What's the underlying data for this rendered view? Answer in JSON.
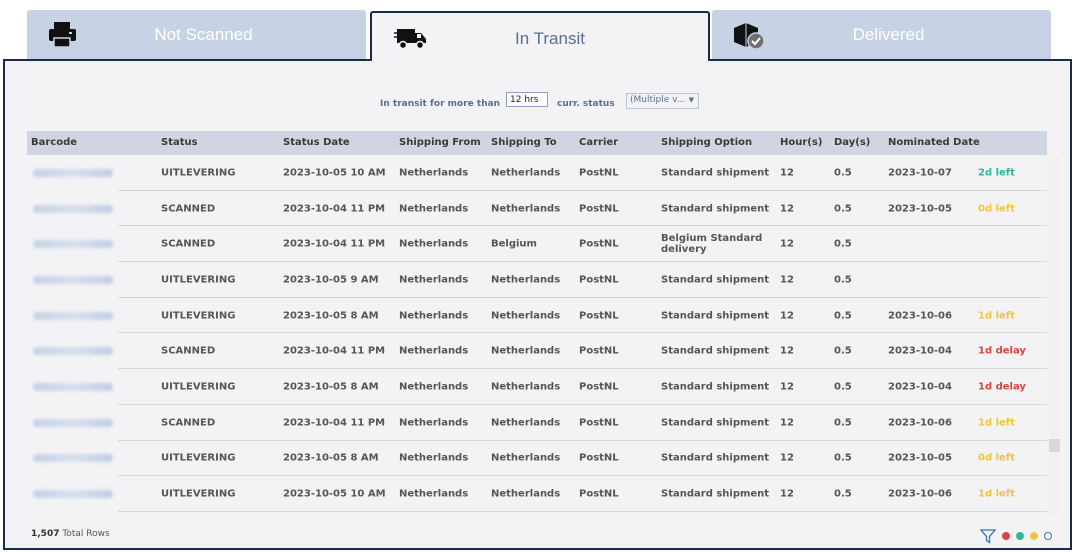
{
  "tabs": [
    {
      "label": "Not Scanned",
      "icon": "printer-icon",
      "active": false
    },
    {
      "label": "In Transit",
      "icon": "truck-icon",
      "active": true
    },
    {
      "label": "Delivered",
      "icon": "package-check-icon",
      "active": false
    }
  ],
  "filters": {
    "in_transit_label": "In transit for more than",
    "hours_value": "12 hrs",
    "status_label": "curr. status",
    "status_value": "(Multiple v...",
    "caret": "▼"
  },
  "table": {
    "columns": [
      "Barcode",
      "Status",
      "Status Date",
      "Shipping From",
      "Shipping To",
      "Carrier",
      "Shipping Option",
      "Hour(s)",
      "Day(s)",
      "Nominated Date"
    ],
    "rows": [
      {
        "status": "UITLEVERING",
        "date": "2023-10-05 10 AM",
        "from": "Netherlands",
        "to": "Netherlands",
        "carrier": "PostNL",
        "option": "Standard shipment",
        "hours": "12",
        "days": "0.5",
        "nominated": "2023-10-07",
        "left": "2d left",
        "left_color": "green"
      },
      {
        "status": "SCANNED",
        "date": "2023-10-04 11 PM",
        "from": "Netherlands",
        "to": "Netherlands",
        "carrier": "PostNL",
        "option": "Standard shipment",
        "hours": "12",
        "days": "0.5",
        "nominated": "2023-10-05",
        "left": "0d left",
        "left_color": "yellow"
      },
      {
        "status": "SCANNED",
        "date": "2023-10-04 11 PM",
        "from": "Netherlands",
        "to": "Belgium",
        "carrier": "PostNL",
        "option": "Belgium Standard\ndelivery",
        "hours": "12",
        "days": "0.5",
        "nominated": "",
        "left": "",
        "left_color": ""
      },
      {
        "status": "UITLEVERING",
        "date": "2023-10-05 9 AM",
        "from": "Netherlands",
        "to": "Netherlands",
        "carrier": "PostNL",
        "option": "Standard shipment",
        "hours": "12",
        "days": "0.5",
        "nominated": "",
        "left": "",
        "left_color": ""
      },
      {
        "status": "UITLEVERING",
        "date": "2023-10-05 8 AM",
        "from": "Netherlands",
        "to": "Netherlands",
        "carrier": "PostNL",
        "option": "Standard shipment",
        "hours": "12",
        "days": "0.5",
        "nominated": "2023-10-06",
        "left": "1d left",
        "left_color": "yellow"
      },
      {
        "status": "SCANNED",
        "date": "2023-10-04 11 PM",
        "from": "Netherlands",
        "to": "Netherlands",
        "carrier": "PostNL",
        "option": "Standard shipment",
        "hours": "12",
        "days": "0.5",
        "nominated": "2023-10-04",
        "left": "1d delay",
        "left_color": "red"
      },
      {
        "status": "UITLEVERING",
        "date": "2023-10-05 8 AM",
        "from": "Netherlands",
        "to": "Netherlands",
        "carrier": "PostNL",
        "option": "Standard shipment",
        "hours": "12",
        "days": "0.5",
        "nominated": "2023-10-04",
        "left": "1d delay",
        "left_color": "red"
      },
      {
        "status": "SCANNED",
        "date": "2023-10-04 11 PM",
        "from": "Netherlands",
        "to": "Netherlands",
        "carrier": "PostNL",
        "option": "Standard shipment",
        "hours": "12",
        "days": "0.5",
        "nominated": "2023-10-06",
        "left": "1d left",
        "left_color": "yellow"
      },
      {
        "status": "UITLEVERING",
        "date": "2023-10-05 8 AM",
        "from": "Netherlands",
        "to": "Netherlands",
        "carrier": "PostNL",
        "option": "Standard shipment",
        "hours": "12",
        "days": "0.5",
        "nominated": "2023-10-05",
        "left": "0d left",
        "left_color": "yellow"
      },
      {
        "status": "UITLEVERING",
        "date": "2023-10-05 10 AM",
        "from": "Netherlands",
        "to": "Netherlands",
        "carrier": "PostNL",
        "option": "Standard shipment",
        "hours": "12",
        "days": "0.5",
        "nominated": "2023-10-06",
        "left": "1d left",
        "left_color": "yellow"
      }
    ]
  },
  "footer": {
    "count": "1,507",
    "count_label": "Total Rows",
    "filter_icon": "funnel-icon",
    "legend_dots": [
      {
        "name": "red-dot",
        "color": "#d9473f"
      },
      {
        "name": "green-dot",
        "color": "#2fb79a"
      },
      {
        "name": "yellow-dot",
        "color": "#f0c53b"
      },
      {
        "name": "white-dot",
        "color": "#ffffff"
      }
    ]
  },
  "colors": {
    "accent": "#1c2b4a",
    "tab_inactive": "#c7d3e4",
    "header": "#cfd6e1"
  }
}
